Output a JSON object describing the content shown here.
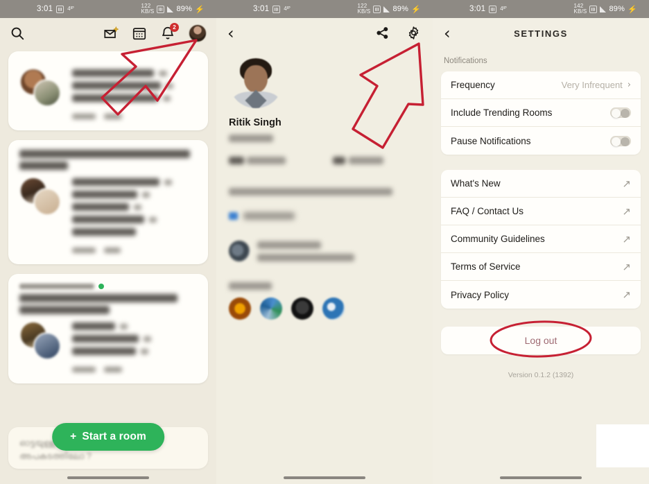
{
  "status_bar": {
    "time": "3:01",
    "battery": "89%",
    "charging_icon": "bolt-icon",
    "signal_icon": "signal-icon",
    "wifi_icon": "wifi-icon",
    "bg_color": "#8e8a84"
  },
  "colors": {
    "background": "#f2efe4",
    "card": "#fffefb",
    "accent_green": "#2eb35a",
    "annotation_red": "#c62033",
    "logout_red": "#9e6a72",
    "badge_red": "#cf2e2e",
    "muted_text": "#8d887e"
  },
  "feed_screen": {
    "name": "home-feed",
    "topbar": {
      "search_icon": "search-icon",
      "invite_icon": "invite-envelope-icon",
      "calendar_icon": "calendar-icon",
      "bell_icon": "bell-icon",
      "bell_badge": "2",
      "avatar": "user-avatar"
    },
    "cards": [
      {
        "club": "",
        "title_lines": [],
        "speakers": [
          "Shweta Sahni",
          "Vignesh Sridhar",
          "Santhosh Kumar"
        ],
        "meta": "17 2"
      },
      {
        "club": "",
        "title_lines": [
          "Mental Health — ways to cope and be",
          "better"
        ],
        "speakers": [
          "Khushboo Malhotra",
          "Shivani Bansal",
          "Srishti Kaul",
          "Aditya Raj Kaul",
          "Harish Kumar"
        ],
        "meta": "104 5"
      },
      {
        "club": "MEDITATION ROOM",
        "title_lines": [
          "Sound Spa: Ocean Ambience to Settle",
          "Your Sleep & Dreams"
        ],
        "speakers": [
          "Hitesh Ojo",
          "Affan Imran",
          "Viraj Rathod"
        ],
        "meta": "103 3"
      }
    ],
    "start_room_button": "Start a room",
    "start_room_plus": "+",
    "bottom_card_lines": [
      "ഓട്ടയുള്ള വഞ്ചിയിൽ",
      "അപകടത്തിലോ ?"
    ]
  },
  "profile_screen": {
    "name": "user-profile",
    "back_icon": "chevron-left-icon",
    "share_icon": "share-icon",
    "settings_icon": "gear-icon",
    "display_name": "Ritik Singh",
    "handle": "@ritiksingh",
    "stats": [
      {
        "count": "250",
        "label": "followers"
      },
      {
        "count": "88",
        "label": "following"
      }
    ],
    "bio": "Motorcycle Enthusiast | Gadget Lover | Blogger",
    "twitter_handle": "@Ritik10Singh",
    "joined": "Joined Feb 5, 2021",
    "nominated_by": "Nominated by Nirmal Samal",
    "member_of_label": "Member of",
    "clubs": [
      "club-orange",
      "club-blue-green",
      "club-black",
      "club-blue-white"
    ]
  },
  "settings_screen": {
    "name": "settings",
    "back_icon": "chevron-left-icon",
    "title": "SETTINGS",
    "notifications_label": "Notifications",
    "notification_rows": [
      {
        "label": "Frequency",
        "value": "Very Infrequent",
        "control": "chevron"
      },
      {
        "label": "Include Trending Rooms",
        "value": "",
        "control": "toggle-off"
      },
      {
        "label": "Pause Notifications",
        "value": "",
        "control": "toggle-off"
      }
    ],
    "link_rows": [
      {
        "label": "What's New"
      },
      {
        "label": "FAQ / Contact Us"
      },
      {
        "label": "Community Guidelines"
      },
      {
        "label": "Terms of Service"
      },
      {
        "label": "Privacy Policy"
      }
    ],
    "logout_label": "Log out",
    "version": "Version 0.1.2 (1392)"
  },
  "annotations": [
    {
      "type": "arrow",
      "target": "profile-avatar-topbar",
      "color": "#c62033"
    },
    {
      "type": "arrow",
      "target": "settings-gear-icon",
      "color": "#c62033"
    },
    {
      "type": "ellipse",
      "target": "logout-button",
      "color": "#c62033"
    }
  ]
}
